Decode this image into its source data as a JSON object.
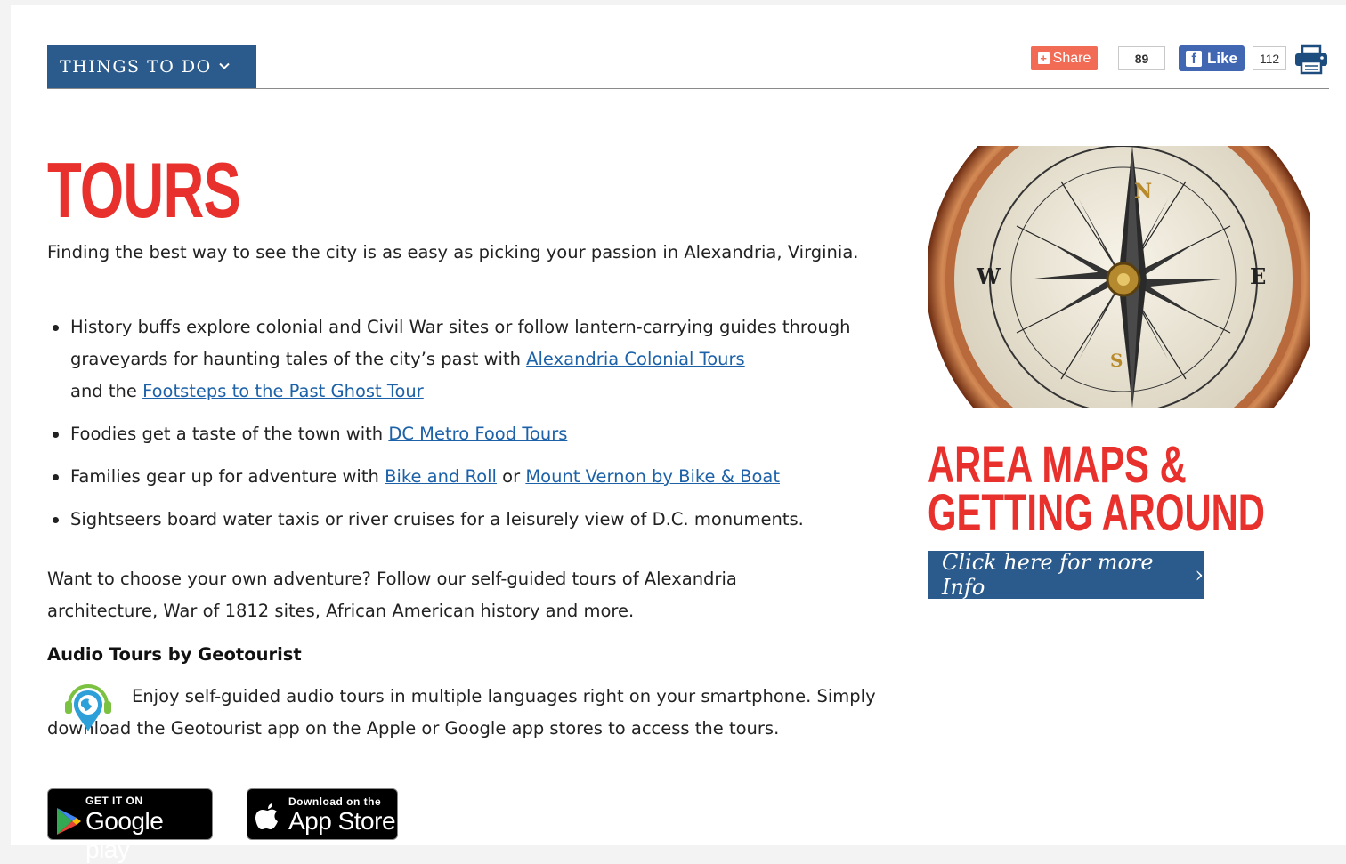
{
  "nav": {
    "things_to_do": "THINGS TO DO",
    "chevron": "⌄"
  },
  "social": {
    "share_label": "Share",
    "share_count": "89",
    "like_label": "Like",
    "like_count": "112"
  },
  "main": {
    "title": "TOURS",
    "intro": "Finding the best way to see the city is as easy as picking your passion in Alexandria, Virginia.",
    "bullets": {
      "b1": {
        "t1": "History buffs explore colonial and Civil War sites or follow lantern-carrying guides through graveyards for haunting tales of the city’s past with ",
        "l1": "Alexandria Colonial Tours",
        "t2": " and the ",
        "l2": "Footsteps to the Past Ghost Tour"
      },
      "b2": {
        "t1": "Foodies get a taste of the town with ",
        "l1": "DC Metro Food Tours"
      },
      "b3": {
        "t1": "Families gear up for adventure with ",
        "l1": "Bike and Roll",
        "t2": " or ",
        "l2": "Mount Vernon by Bike & Boat"
      },
      "b4": {
        "t1": "Sightseers board water taxis or river cruises for a leisurely view of D.C. monuments."
      }
    },
    "adventure": "Want to choose your own adventure? Follow our self-guided tours of Alexandria architecture, War of 1812 sites, African American history and more.",
    "audio_heading": "Audio Tours by Geotourist",
    "audio_text": "Enjoy self-guided audio tours in multiple languages right on your smartphone. Simply download the Geotourist app on the Apple or Google app stores to access the tours.",
    "google_play": {
      "small": "GET IT ON",
      "big": "Google play"
    },
    "app_store": {
      "small": "Download on the",
      "big": "App Store"
    }
  },
  "sidebar": {
    "compass_letters": {
      "n": "N",
      "e": "E",
      "s": "S",
      "w": "W"
    },
    "title": "AREA MAPS & GETTING AROUND",
    "button": "Click here for more Info",
    "button_arrow": "›"
  },
  "colors": {
    "accent_red": "#e8312c",
    "nav_blue": "#2a5b8c",
    "link_blue": "#1d62a8",
    "share_orange": "#f26b55",
    "facebook_blue": "#4267b2",
    "geo_green": "#7cc242",
    "geo_blue": "#2d9fd9"
  },
  "icons": [
    "chevron-down-icon",
    "share-plus-icon",
    "facebook-icon",
    "printer-icon",
    "geotourist-icon",
    "google-play-icon",
    "apple-icon",
    "compass-image"
  ]
}
